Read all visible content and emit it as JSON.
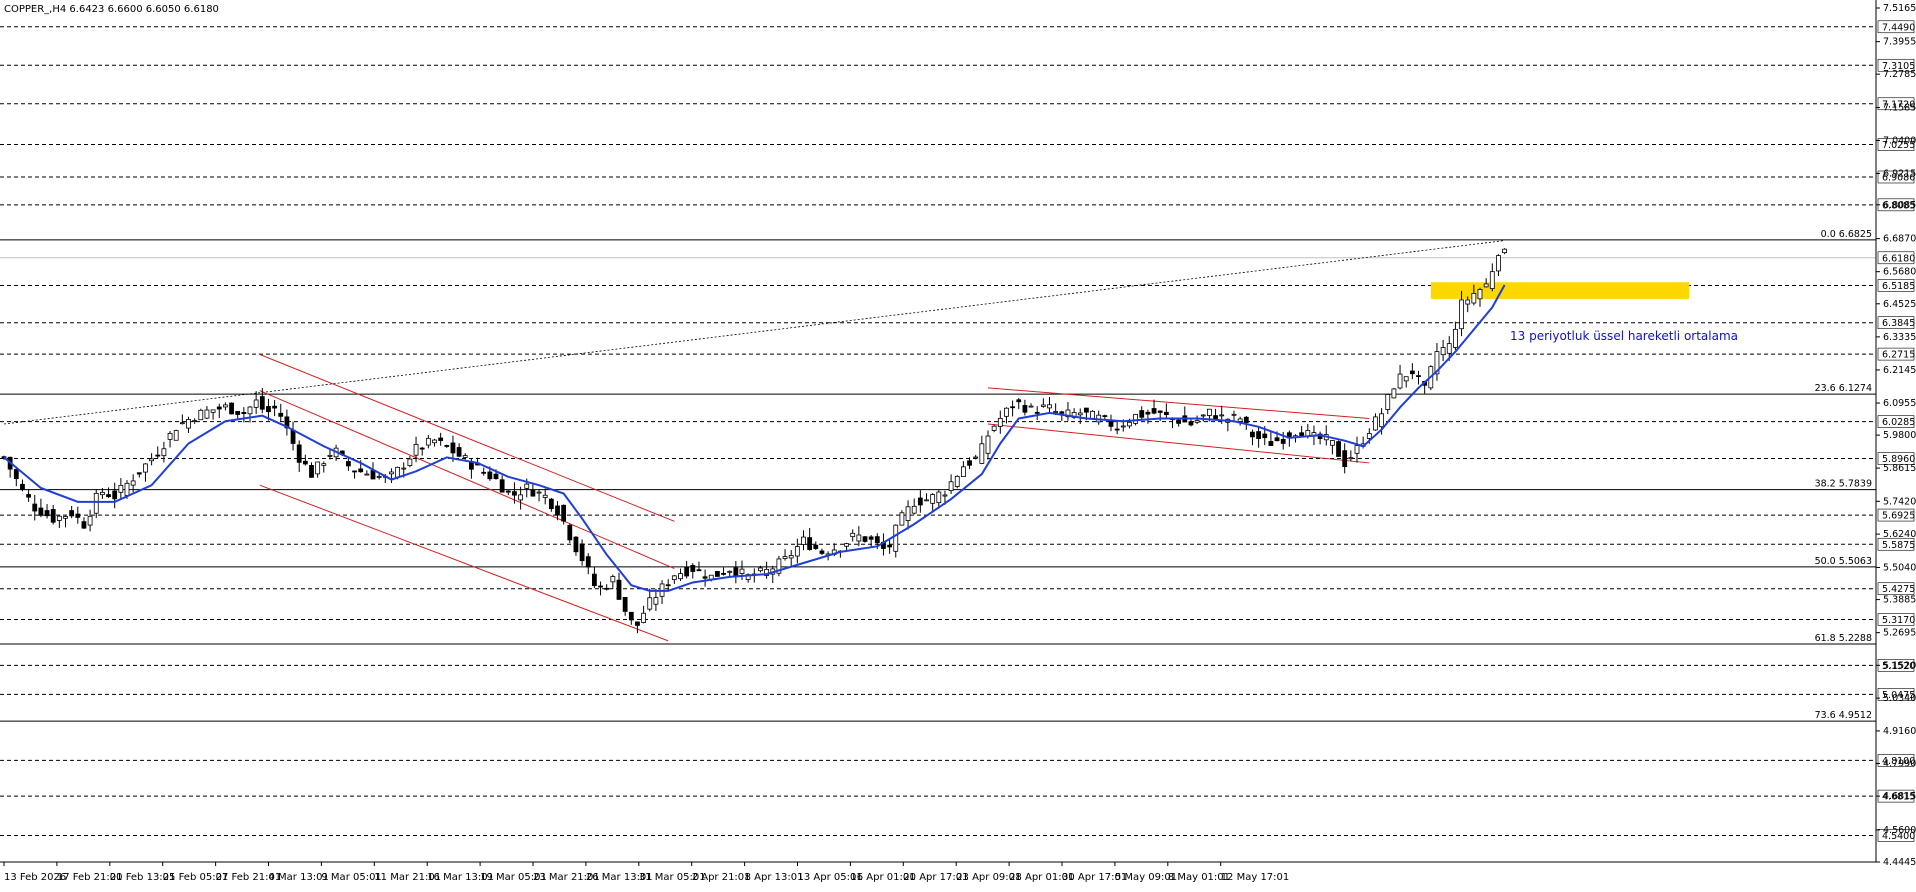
{
  "chart_data": {
    "type": "candlestick",
    "symbol_header": "COPPER_,H4  6.6423 6.6600 6.6050 6.6180",
    "ylim": [
      4.4445,
      7.5165
    ],
    "y_ticks": [
      "7.5165",
      "7.3955",
      "7.2785",
      "7.1585",
      "7.0400",
      "6.9215",
      "6.8085",
      "6.6870",
      "6.5680",
      "6.4525",
      "6.3335",
      "6.2145",
      "6.0955",
      "5.9800",
      "5.8615",
      "5.7420",
      "5.6240",
      "5.5040",
      "5.3885",
      "5.2695",
      "5.1520",
      "5.0340",
      "4.9160",
      "4.7990",
      "4.6815",
      "4.5600",
      "4.4445"
    ],
    "x_labels": [
      "13 Feb 2026",
      "17 Feb 21:01",
      "20 Feb 13:01",
      "25 Feb 05:01",
      "27 Feb 21:01",
      "4 Mar 13:01",
      "9 Mar 05:01",
      "11 Mar 21:01",
      "16 Mar 13:01",
      "19 Mar 05:01",
      "23 Mar 21:01",
      "26 Mar 13:01",
      "31 Mar 05:01",
      "2 Apr 21:01",
      "8 Apr 13:01",
      "13 Apr 05:01",
      "16 Apr 01:01",
      "20 Apr 17:01",
      "23 Apr 09:01",
      "28 Apr 01:01",
      "30 Apr 17:01",
      "5 May 09:01",
      "8 May 01:01",
      "12 May 17:01"
    ],
    "horizontal_levels": [
      "7.4490",
      "7.3105",
      "7.1720",
      "7.0255",
      "6.9086",
      "6.8085",
      "6.6180",
      "6.5185",
      "6.3845",
      "6.2715",
      "6.0285",
      "5.8960",
      "5.6925",
      "5.5875",
      "5.4275",
      "5.3170",
      "5.1520",
      "5.0475",
      "4.8100",
      "4.6815",
      "4.5400"
    ],
    "current_price": "6.6180",
    "fibonacci": [
      {
        "label": "0.0 6.6825",
        "value": 6.6825
      },
      {
        "label": "23.6 6.1274",
        "value": 6.1274
      },
      {
        "label": "38.2 5.7839",
        "value": 5.7839
      },
      {
        "label": "50.0 5.5063",
        "value": 5.5063
      },
      {
        "label": "61.8 5.2288",
        "value": 5.2288
      },
      {
        "label": "73.6 4.9512",
        "value": 4.9512
      }
    ],
    "annotation": "13 periyotluk üssel hareketli ortalama",
    "key_points": [
      [
        0,
        5.9
      ],
      [
        15,
        5.78
      ],
      [
        25,
        5.72
      ],
      [
        40,
        5.68
      ],
      [
        55,
        5.7
      ],
      [
        65,
        5.66
      ],
      [
        78,
        5.78
      ],
      [
        90,
        5.76
      ],
      [
        108,
        5.84
      ],
      [
        125,
        5.92
      ],
      [
        140,
        6.01
      ],
      [
        155,
        6.05
      ],
      [
        168,
        6.07
      ],
      [
        180,
        6.08
      ],
      [
        195,
        6.06
      ],
      [
        205,
        6.1
      ],
      [
        213,
        6.06
      ],
      [
        222,
        6.08
      ],
      [
        230,
        6.0
      ],
      [
        240,
        5.9
      ],
      [
        250,
        5.84
      ],
      [
        258,
        5.88
      ],
      [
        268,
        5.93
      ],
      [
        282,
        5.86
      ],
      [
        298,
        5.84
      ],
      [
        312,
        5.82
      ],
      [
        322,
        5.86
      ],
      [
        335,
        5.93
      ],
      [
        350,
        5.96
      ],
      [
        362,
        5.93
      ],
      [
        372,
        5.9
      ],
      [
        385,
        5.86
      ],
      [
        400,
        5.82
      ],
      [
        412,
        5.76
      ],
      [
        425,
        5.79
      ],
      [
        440,
        5.76
      ],
      [
        452,
        5.7
      ],
      [
        462,
        5.6
      ],
      [
        472,
        5.52
      ],
      [
        482,
        5.42
      ],
      [
        495,
        5.46
      ],
      [
        505,
        5.35
      ],
      [
        513,
        5.28
      ],
      [
        522,
        5.36
      ],
      [
        533,
        5.42
      ],
      [
        545,
        5.48
      ],
      [
        560,
        5.5
      ],
      [
        575,
        5.47
      ],
      [
        590,
        5.5
      ],
      [
        605,
        5.47
      ],
      [
        620,
        5.49
      ],
      [
        635,
        5.53
      ],
      [
        650,
        5.6
      ],
      [
        665,
        5.56
      ],
      [
        680,
        5.58
      ],
      [
        692,
        5.62
      ],
      [
        705,
        5.6
      ],
      [
        718,
        5.56
      ],
      [
        728,
        5.67
      ],
      [
        740,
        5.74
      ],
      [
        752,
        5.75
      ],
      [
        765,
        5.78
      ],
      [
        780,
        5.87
      ],
      [
        792,
        5.9
      ],
      [
        802,
        6.0
      ],
      [
        812,
        6.05
      ],
      [
        822,
        6.1
      ],
      [
        835,
        6.07
      ],
      [
        848,
        6.08
      ],
      [
        860,
        6.05
      ],
      [
        875,
        6.06
      ],
      [
        890,
        6.04
      ],
      [
        905,
        6.01
      ],
      [
        920,
        6.05
      ],
      [
        935,
        6.06
      ],
      [
        950,
        6.04
      ],
      [
        965,
        6.02
      ],
      [
        980,
        6.06
      ],
      [
        992,
        6.04
      ],
      [
        1005,
        6.04
      ],
      [
        1015,
        5.98
      ],
      [
        1028,
        5.95
      ],
      [
        1040,
        5.97
      ],
      [
        1052,
        6.0
      ],
      [
        1065,
        5.97
      ],
      [
        1078,
        5.96
      ],
      [
        1090,
        5.88
      ],
      [
        1100,
        5.93
      ],
      [
        1110,
        6.0
      ],
      [
        1120,
        6.06
      ],
      [
        1132,
        6.18
      ],
      [
        1145,
        6.21
      ],
      [
        1155,
        6.14
      ],
      [
        1165,
        6.28
      ],
      [
        1175,
        6.3
      ],
      [
        1185,
        6.45
      ],
      [
        1195,
        6.49
      ],
      [
        1205,
        6.52
      ],
      [
        1212,
        6.6
      ],
      [
        1216,
        6.66
      ],
      [
        1220,
        6.63
      ]
    ],
    "ema_points": [
      [
        0,
        5.9
      ],
      [
        30,
        5.79
      ],
      [
        60,
        5.74
      ],
      [
        90,
        5.74
      ],
      [
        120,
        5.8
      ],
      [
        150,
        5.95
      ],
      [
        180,
        6.03
      ],
      [
        210,
        6.05
      ],
      [
        230,
        6.01
      ],
      [
        260,
        5.94
      ],
      [
        290,
        5.88
      ],
      [
        315,
        5.82
      ],
      [
        335,
        5.85
      ],
      [
        360,
        5.9
      ],
      [
        385,
        5.88
      ],
      [
        410,
        5.83
      ],
      [
        435,
        5.8
      ],
      [
        455,
        5.77
      ],
      [
        470,
        5.68
      ],
      [
        490,
        5.55
      ],
      [
        510,
        5.44
      ],
      [
        525,
        5.42
      ],
      [
        540,
        5.42
      ],
      [
        560,
        5.45
      ],
      [
        590,
        5.47
      ],
      [
        620,
        5.48
      ],
      [
        650,
        5.52
      ],
      [
        680,
        5.56
      ],
      [
        710,
        5.58
      ],
      [
        740,
        5.66
      ],
      [
        770,
        5.75
      ],
      [
        795,
        5.84
      ],
      [
        810,
        5.95
      ],
      [
        825,
        6.04
      ],
      [
        850,
        6.06
      ],
      [
        880,
        6.04
      ],
      [
        910,
        6.03
      ],
      [
        940,
        6.04
      ],
      [
        970,
        6.04
      ],
      [
        1000,
        6.03
      ],
      [
        1020,
        6.01
      ],
      [
        1045,
        5.97
      ],
      [
        1070,
        5.98
      ],
      [
        1090,
        5.96
      ],
      [
        1105,
        5.94
      ],
      [
        1120,
        6.0
      ],
      [
        1135,
        6.08
      ],
      [
        1150,
        6.15
      ],
      [
        1165,
        6.21
      ],
      [
        1180,
        6.28
      ],
      [
        1195,
        6.36
      ],
      [
        1210,
        6.44
      ],
      [
        1220,
        6.52
      ]
    ],
    "channels": [
      {
        "name": "falling-channel-top",
        "from": [
          208,
          6.27
        ],
        "to": [
          545,
          5.67
        ]
      },
      {
        "name": "falling-channel-mid",
        "from": [
          208,
          6.14
        ],
        "to": [
          545,
          5.5
        ]
      },
      {
        "name": "falling-channel-bottom",
        "from": [
          208,
          5.8
        ],
        "to": [
          540,
          5.24
        ]
      },
      {
        "name": "flag-top",
        "from": [
          800,
          6.15
        ],
        "to": [
          1110,
          6.04
        ]
      },
      {
        "name": "flag-bottom",
        "from": [
          800,
          6.02
        ],
        "to": [
          1110,
          5.88
        ]
      }
    ],
    "trendline": {
      "from": [
        0,
        6.02
      ],
      "to": [
        1220,
        6.68
      ]
    },
    "zone": {
      "from_x": 1160,
      "to_x": 1370,
      "low": 6.47,
      "high": 6.53,
      "color": "#ffd700"
    },
    "colors": {
      "ema": "#1f3fd6",
      "channel": "#d22020",
      "zone": "#ffd700",
      "candle": "#000000",
      "annotation": "#1010d0"
    },
    "grid": false
  }
}
